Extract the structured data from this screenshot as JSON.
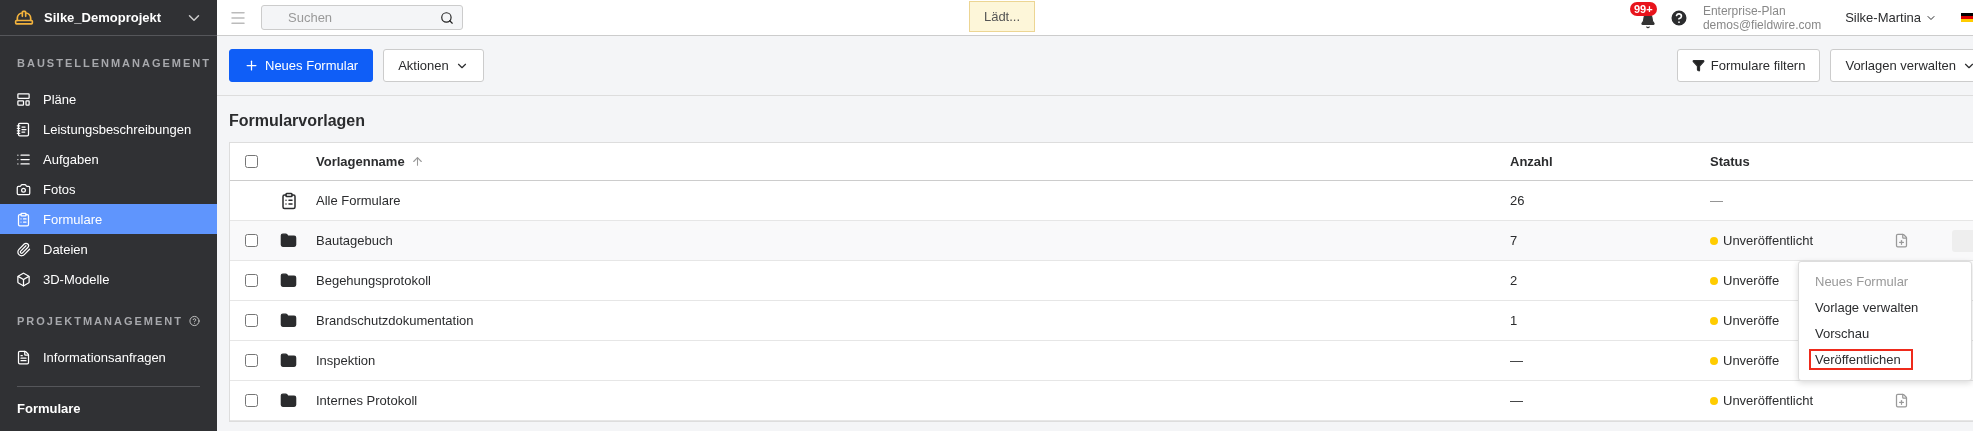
{
  "project": {
    "name": "Silke_Demoprojekt"
  },
  "sidebar": {
    "sections": [
      {
        "title": "BAUSTELLENMANAGEMENT",
        "help": false,
        "items": [
          {
            "label": "Pläne",
            "selected": false
          },
          {
            "label": "Leistungsbeschreibungen",
            "selected": false
          },
          {
            "label": "Aufgaben",
            "selected": false
          },
          {
            "label": "Fotos",
            "selected": false
          },
          {
            "label": "Formulare",
            "selected": true
          },
          {
            "label": "Dateien",
            "selected": false
          },
          {
            "label": "3D-Modelle",
            "selected": false
          }
        ]
      },
      {
        "title": "PROJEKTMANAGEMENT",
        "help": true,
        "items": [
          {
            "label": "Informationsanfragen",
            "selected": false
          }
        ]
      }
    ],
    "footer": "Formulare"
  },
  "topbar": {
    "search": {
      "placeholder": "Suchen"
    },
    "loading": "Lädt...",
    "notifications": "99+",
    "plan": "Enterprise-Plan",
    "email": "demos@fieldwire.com",
    "user": "Silke-Martina"
  },
  "toolbar": {
    "primary": "Neues Formular",
    "actions": "Aktionen",
    "filter": "Formulare filtern",
    "templates": "Vorlagen verwalten"
  },
  "table": {
    "title": "Formularvorlagen",
    "header_checked": false,
    "columns": [
      "Vorlagenname",
      "Anzahl",
      "Status"
    ],
    "rows": [
      {
        "kind": "all",
        "name": "Alle Formulare",
        "count": "26",
        "status": "—"
      },
      {
        "kind": "folder",
        "name": "Bautagebuch",
        "count": "7",
        "status": "Unveröffentlicht",
        "color": "#ffcc00",
        "checked": false,
        "hovered": true,
        "action_icon": true
      },
      {
        "kind": "folder",
        "name": "Begehungsprotokoll",
        "count": "2",
        "status": "Unveröffe",
        "color": "#ffcc00",
        "checked": false,
        "hovered": false
      },
      {
        "kind": "folder",
        "name": "Brandschutzdokumentation",
        "count": "1",
        "status": "Unveröffe",
        "color": "#ffcc00",
        "checked": false,
        "hovered": false
      },
      {
        "kind": "folder",
        "name": "Inspektion",
        "count": "—",
        "status": "Unveröffe",
        "color": "#ffcc00",
        "checked": false,
        "hovered": false
      },
      {
        "kind": "folder",
        "name": "Internes Protokoll",
        "count": "—",
        "status": "Unveröffentlicht",
        "color": "#ffcc00",
        "checked": false,
        "hovered": false,
        "action_icon": true
      }
    ]
  },
  "menu": {
    "items": [
      {
        "label": "Neues Formular",
        "disabled": true,
        "highlighted": false
      },
      {
        "label": "Vorlage verwalten",
        "disabled": false,
        "highlighted": false
      },
      {
        "label": "Vorschau",
        "disabled": false,
        "highlighted": false
      },
      {
        "label": "Veröffentlichen",
        "disabled": false,
        "highlighted": true
      }
    ]
  }
}
